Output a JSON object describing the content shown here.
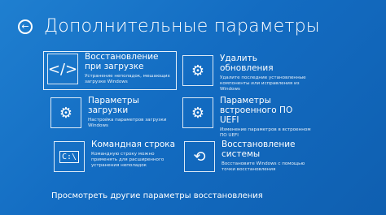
{
  "header": {
    "title": "Дополнительные параметры"
  },
  "options": [
    {
      "title": "Восстановление при загрузке",
      "desc": "Устранение неполадок, мешающих загрузке Windows",
      "icon": "code-icon"
    },
    {
      "title": "Удалить обновления",
      "desc": "Удалите последние установленные компоненты или исправления из Windows",
      "icon": "gear-icon"
    },
    {
      "title": "Параметры загрузки",
      "desc": "Настройка параметров загрузки Windows",
      "icon": "gear-icon"
    },
    {
      "title": "Параметры встроенного ПО UEFI",
      "desc": "Изменение параметров в встроенном ПО UEFI",
      "icon": "chip-gear-icon"
    },
    {
      "title": "Командная строка",
      "desc": "Командную строку можно применять для расширенного устранения неполадок",
      "icon": "command-prompt-icon"
    },
    {
      "title": "Восстановление системы",
      "desc": "Восстановите Windows с помощью точки восстановления",
      "icon": "restore-icon"
    }
  ],
  "footer": {
    "more_link": "Просмотреть другие параметры восстановления"
  },
  "colors": {
    "background": "#136cc2",
    "text": "#ffffff"
  }
}
